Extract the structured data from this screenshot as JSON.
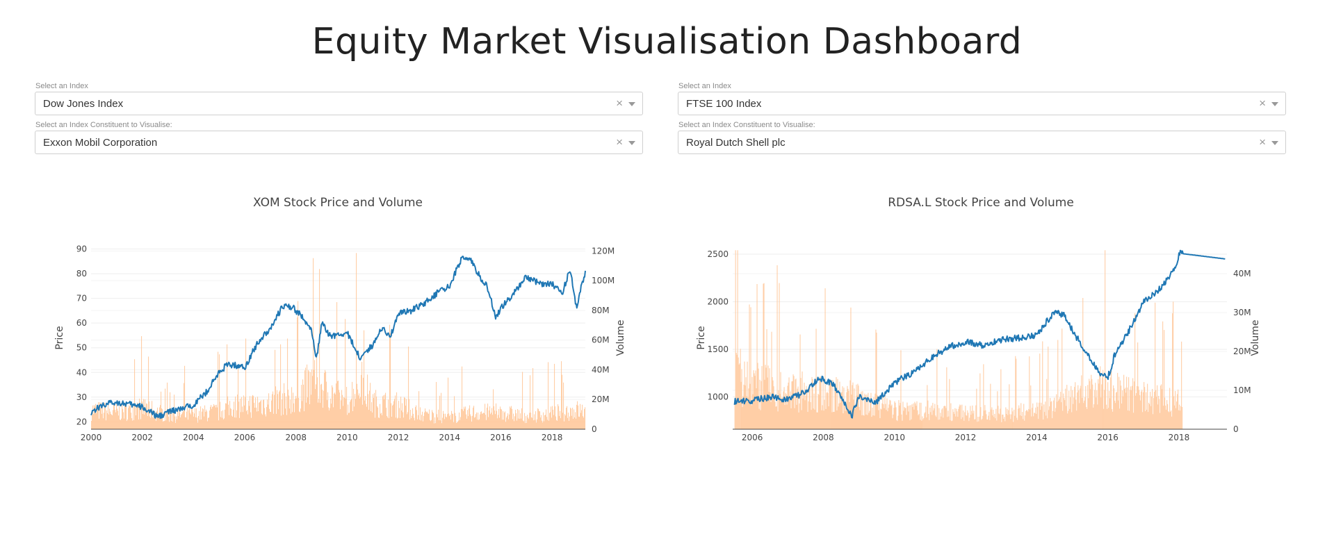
{
  "page": {
    "title": "Equity Market Visualisation Dashboard"
  },
  "left_panel": {
    "index_label": "Select an Index",
    "index_value": "Dow Jones Index",
    "constituent_label": "Select an Index Constituent to Visualise:",
    "constituent_value": "Exxon Mobil Corporation"
  },
  "right_panel": {
    "index_label": "Select an Index",
    "index_value": "FTSE 100 Index",
    "constituent_label": "Select an Index Constituent to Visualise:",
    "constituent_value": "Royal Dutch Shell plc"
  },
  "icons": {
    "clear": "×",
    "dropdown": "chevron-down-icon"
  },
  "colors": {
    "price_line": "#1f77b4",
    "volume_bars": "#ffc99c",
    "grid": "#eeeeee"
  },
  "chart_data": [
    {
      "type": "line",
      "title": "XOM Stock Price and Volume",
      "ylabel": "Price",
      "y2label": "Volume",
      "xlim": [
        2000,
        2019.3
      ],
      "ylim": [
        17,
        91
      ],
      "y2lim": [
        0,
        123
      ],
      "x_ticks": [
        2000,
        2002,
        2004,
        2006,
        2008,
        2010,
        2012,
        2014,
        2016,
        2018
      ],
      "y_ticks": [
        20,
        30,
        40,
        50,
        60,
        70,
        80,
        90
      ],
      "y2_ticks": [
        0,
        20,
        40,
        60,
        80,
        100,
        120
      ],
      "y2_tick_labels": [
        "0",
        "20M",
        "40M",
        "60M",
        "80M",
        "100M",
        "120M"
      ],
      "legend": "none",
      "series": [
        {
          "name": "Price",
          "x": [
            2000.0,
            2000.5,
            2001.0,
            2001.5,
            2002.0,
            2002.6,
            2003.0,
            2003.5,
            2004.0,
            2004.5,
            2005.0,
            2005.3,
            2005.6,
            2006.0,
            2006.5,
            2007.0,
            2007.5,
            2007.9,
            2008.3,
            2008.6,
            2008.8,
            2009.0,
            2009.3,
            2009.6,
            2010.0,
            2010.5,
            2011.0,
            2011.3,
            2011.7,
            2012.0,
            2012.5,
            2013.0,
            2013.5,
            2014.0,
            2014.5,
            2014.8,
            2015.0,
            2015.5,
            2015.8,
            2016.0,
            2016.5,
            2017.0,
            2017.5,
            2018.0,
            2018.4,
            2018.7,
            2018.95,
            2019.15,
            2019.3
          ],
          "y": [
            24,
            27,
            28,
            27,
            26,
            22,
            24,
            25,
            27,
            32,
            40,
            43,
            43,
            42,
            52,
            58,
            67,
            66,
            62,
            57,
            45,
            60,
            55,
            55,
            56,
            46,
            51,
            58,
            55,
            64,
            65,
            68,
            72,
            75,
            87,
            86,
            82,
            74,
            62,
            66,
            72,
            79,
            76,
            76,
            72,
            82,
            66,
            76,
            80
          ]
        },
        {
          "name": "Volume",
          "x": [
            2000.0,
            2001.0,
            2002.0,
            2003.0,
            2004.0,
            2005.0,
            2005.5,
            2006.0,
            2007.0,
            2008.0,
            2008.8,
            2009.0,
            2009.5,
            2010.0,
            2010.5,
            2011.0,
            2012.0,
            2013.0,
            2014.0,
            2015.0,
            2016.0,
            2017.0,
            2018.0,
            2019.0,
            2019.3
          ],
          "y": [
            16,
            14,
            18,
            12,
            12,
            15,
            20,
            20,
            22,
            28,
            42,
            36,
            28,
            24,
            40,
            22,
            20,
            12,
            10,
            14,
            14,
            11,
            13,
            16,
            14
          ]
        }
      ]
    },
    {
      "type": "line",
      "title": "RDSA.L Stock Price and Volume",
      "ylabel": "Price",
      "y2label": "Volume",
      "xlim": [
        2005.45,
        2019.35
      ],
      "ylim": [
        660,
        2580
      ],
      "y2lim": [
        0,
        47
      ],
      "x_ticks": [
        2006,
        2008,
        2010,
        2012,
        2014,
        2016,
        2018
      ],
      "y_ticks": [
        1000,
        1500,
        2000,
        2500
      ],
      "y2_ticks": [
        0,
        10,
        20,
        30,
        40
      ],
      "y2_tick_labels": [
        "0",
        "10M",
        "20M",
        "30M",
        "40M"
      ],
      "legend": "none",
      "series": [
        {
          "name": "Price",
          "x": [
            2005.5,
            2006.0,
            2006.5,
            2007.0,
            2007.5,
            2007.9,
            2008.3,
            2008.8,
            2009.0,
            2009.5,
            2010.0,
            2010.5,
            2011.0,
            2011.5,
            2012.0,
            2012.5,
            2013.0,
            2013.5,
            2014.0,
            2014.5,
            2014.8,
            2015.0,
            2015.5,
            2015.8,
            2016.0,
            2016.2,
            2016.6,
            2017.0,
            2017.5,
            2017.9,
            2018.0,
            2019.3
          ],
          "y": [
            950,
            960,
            1000,
            970,
            1050,
            1200,
            1120,
            800,
            1000,
            950,
            1150,
            1250,
            1400,
            1520,
            1580,
            1540,
            1600,
            1620,
            1650,
            1900,
            1850,
            1700,
            1400,
            1250,
            1200,
            1450,
            1700,
            2000,
            2150,
            2350,
            2510,
            2450
          ]
        },
        {
          "name": "Volume",
          "x": [
            2005.5,
            2006.0,
            2007.0,
            2008.0,
            2008.8,
            2009.5,
            2010.0,
            2011.0,
            2012.0,
            2013.0,
            2014.0,
            2015.0,
            2015.8,
            2016.2,
            2017.0,
            2018.0
          ],
          "y": [
            18,
            14,
            12,
            12,
            10,
            8,
            6,
            6,
            5,
            5,
            6,
            10,
            14,
            12,
            10,
            9
          ]
        }
      ]
    }
  ]
}
